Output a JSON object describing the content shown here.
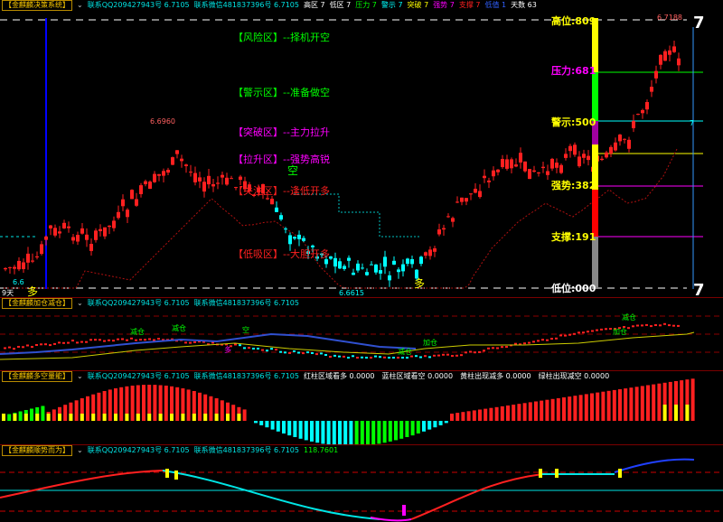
{
  "colors": {
    "up": "#ff2020",
    "down": "#00ffff",
    "yellow": "#ffff00",
    "green": "#00ff00",
    "magenta": "#ff00ff",
    "blue": "#0000ff",
    "grid": "#8b0000",
    "orange": "#ffcc00"
  },
  "panel1": {
    "title": "【金麒麟决策系统】",
    "dropdown_icon": "chevron-down-icon",
    "contact1": "联系QQ209427943号 6.7105",
    "contact2": "联系微信481837396号 6.7105",
    "legend": [
      {
        "label": "高区 7",
        "color": "#ffffff"
      },
      {
        "label": "低区 7",
        "color": "#ffffff"
      },
      {
        "label": "压力 7",
        "color": "#00ff00"
      },
      {
        "label": "警示 7",
        "color": "#00ffff"
      },
      {
        "label": "突破 7",
        "color": "#ffff00"
      },
      {
        "label": "强势 7",
        "color": "#ff00ff"
      },
      {
        "label": "支撑 7",
        "color": "#ff2020"
      },
      {
        "label": "低值 1",
        "color": "#3060ff"
      },
      {
        "label": "天数 63",
        "color": "#ffffff"
      }
    ],
    "zones": [
      {
        "label": "【风险区】--择机开空",
        "color": "#00ff00"
      },
      {
        "label": "【警示区】--准备做空",
        "color": "#00ff00"
      },
      {
        "label": "【突破区】--主力拉升",
        "color": "#ff00ff"
      },
      {
        "label": "【拉升区】--强势高锐",
        "color": "#ff00ff"
      },
      {
        "label": "【关注区】--逢低开多",
        "color": "#ff2020"
      },
      {
        "label": "【低吸区】--大胆开多",
        "color": "#ff2020"
      }
    ],
    "levels": [
      {
        "label": "高位:809",
        "value": 809,
        "color": "#ffff00"
      },
      {
        "label": "压力:681",
        "value": 681,
        "color": "#ff00ff"
      },
      {
        "label": "警示:500",
        "value": 500,
        "color": "#ffff00"
      },
      {
        "label": "强势:382",
        "value": 382,
        "color": "#ffff00"
      },
      {
        "label": "支撑:191",
        "value": 191,
        "color": "#ffff00"
      },
      {
        "label": "低位:000",
        "value": 0,
        "color": "#ffffff"
      }
    ],
    "big_seven": "7",
    "small_seven": "7",
    "price_high_label": "6.6960",
    "price_low_label": "6.6615",
    "price_max_label": "6.7188",
    "left_price_label": "6.6",
    "day_label": "9天",
    "kong_label": "空",
    "duo_label": "多"
  },
  "panel2": {
    "title": "【金麒麟加仓减仓】",
    "contact1": "联系QQ209427943号 6.7105",
    "contact2": "联系微信481837396号 6.7105",
    "marks": [
      "减仓",
      "空",
      "减仓",
      "多",
      "加仓",
      "减仓",
      "减仓",
      "加仓"
    ]
  },
  "panel3": {
    "title": "【金麒麟多空量能】",
    "contact1": "联系QQ209427943号 6.7105",
    "contact2": "联系微信481837396号 6.7105",
    "legend": [
      {
        "label": "红柱区域看多 0.0000",
        "color": "#ffffff"
      },
      {
        "label": "蓝柱区域看空 0.0000",
        "color": "#ffffff"
      },
      {
        "label": "黄柱出现减多 0.0000",
        "color": "#ffffff"
      },
      {
        "label": "绿柱出现减空 0.0000",
        "color": "#ffffff"
      }
    ]
  },
  "panel4": {
    "title": "【金麒麟顺势而为】",
    "contact1": "联系QQ209427943号 6.7105",
    "contact2": "联系微信481837396号 6.7105",
    "value": "118.7601"
  },
  "chart_data": [
    {
      "type": "candlestick",
      "title": "金麒麟决策系统",
      "ylim": [
        6.66,
        6.72
      ],
      "annotated_prices": {
        "high_left": 6.696,
        "low": 6.6615,
        "high_right": 6.7188
      },
      "levels": [
        809,
        681,
        500,
        382,
        191,
        0
      ]
    },
    {
      "type": "line",
      "title": "金麒麟加仓减仓",
      "series": []
    },
    {
      "type": "bar",
      "title": "金麒麟多空量能",
      "series": []
    },
    {
      "type": "line",
      "title": "金麒麟顺势而为",
      "value": 118.7601
    }
  ]
}
